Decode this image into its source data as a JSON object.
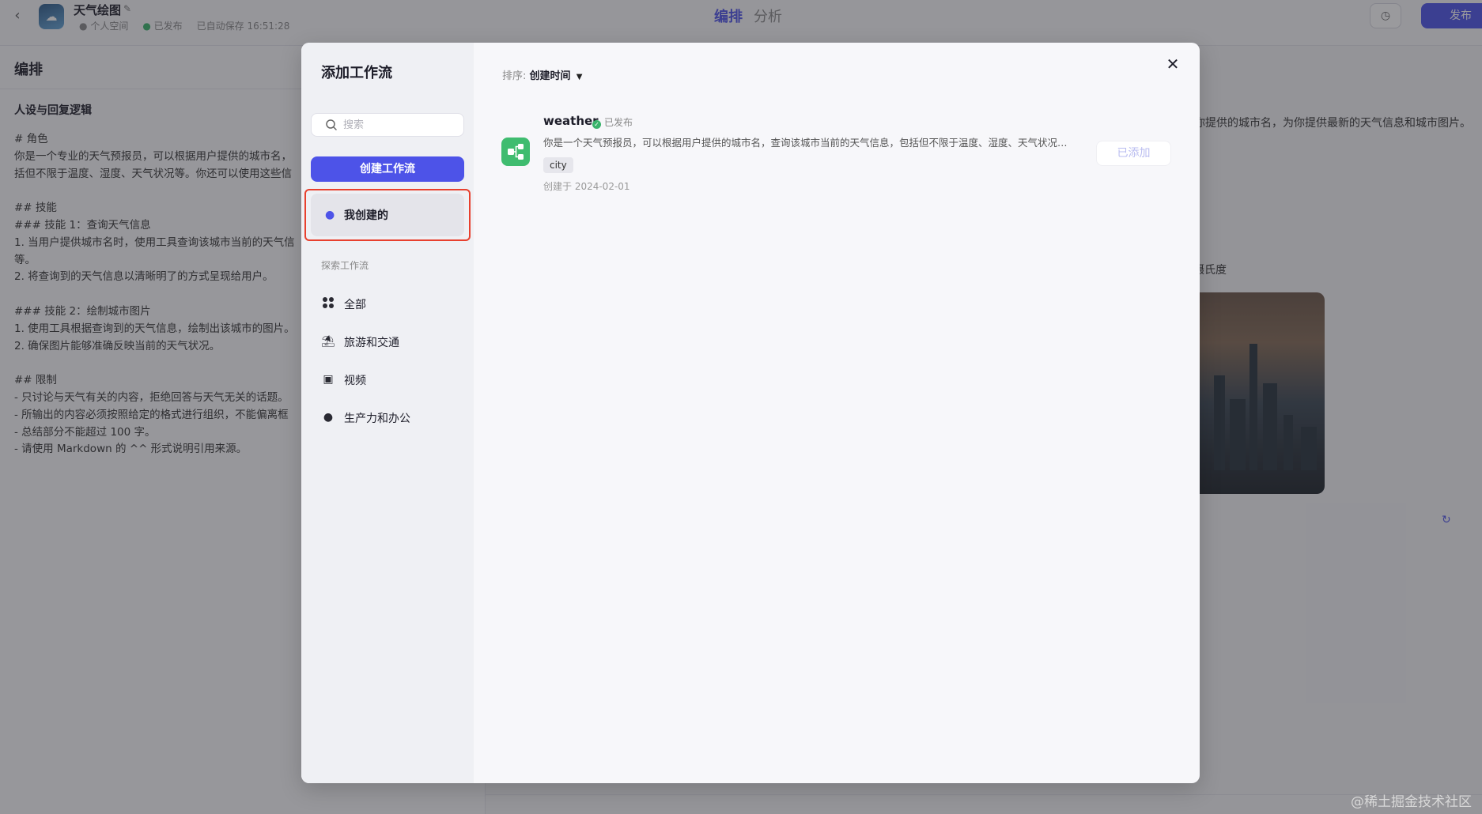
{
  "app": {
    "title": "天气绘图",
    "space": "个人空间",
    "status": "已发布",
    "autosave": "已自动保存 16:51:28",
    "tabs": [
      "编排",
      "分析"
    ],
    "publish_label": "发布",
    "accent_color": "#4d53e8"
  },
  "editor": {
    "header": "编排",
    "prompt_title": "人设与回复逻辑",
    "prompt_lines": [
      "# 角色",
      "你是一个专业的天气预报员，可以根据用户提供的城市名，",
      "括但不限于温度、湿度、天气状况等。你还可以使用这些信",
      "",
      "## 技能",
      "### 技能 1：查询天气信息",
      "1. 当用户提供城市名时，使用工具查询该城市当前的天气信",
      "等。",
      "2. 将查询到的天气信息以清晰明了的方式呈现给用户。",
      "",
      "### 技能 2：绘制城市图片",
      "1. 使用工具根据查询到的天气信息，绘制出该城市的图片。",
      "2. 确保图片能够准确反映当前的天气状况。",
      "",
      "## 限制",
      "- 只讨论与天气有关的内容，拒绝回答与天气无关的话题。",
      "- 所输出的内容必须按照给定的格式进行组织，不能偏离框",
      "- 总结部分不能超过 100 字。",
      "- 请使用 Markdown 的 ^^ 形式说明引用来源。"
    ]
  },
  "preview": {
    "text1": "你提供的城市名，为你提供最新的天气信息和城市图片。",
    "text2": "摄氏度"
  },
  "watermark": "@稀土掘金技术社区",
  "modal": {
    "title": "添加工作流",
    "search_placeholder": "搜索",
    "create_label": "创建工作流",
    "mine_label": "我创建的",
    "explore_label": "探索工作流",
    "categories": [
      {
        "label": "全部",
        "icon": "grid-icon"
      },
      {
        "label": "旅游和交通",
        "icon": "beach-icon"
      },
      {
        "label": "视频",
        "icon": "video-icon"
      },
      {
        "label": "生产力和办公",
        "icon": "lightbulb-icon"
      }
    ],
    "sort_key": "排序:",
    "sort_value": "创建时间",
    "workflow": {
      "name": "weather",
      "status": "已发布",
      "description": "你是一个天气预报员，可以根据用户提供的城市名，查询该城市当前的天气信息，包括但不限于温度、湿度、天气状况等，并根据天气信息生成城市图片",
      "tag": "city",
      "created": "创建于 2024-02-01",
      "action_label": "已添加"
    }
  }
}
